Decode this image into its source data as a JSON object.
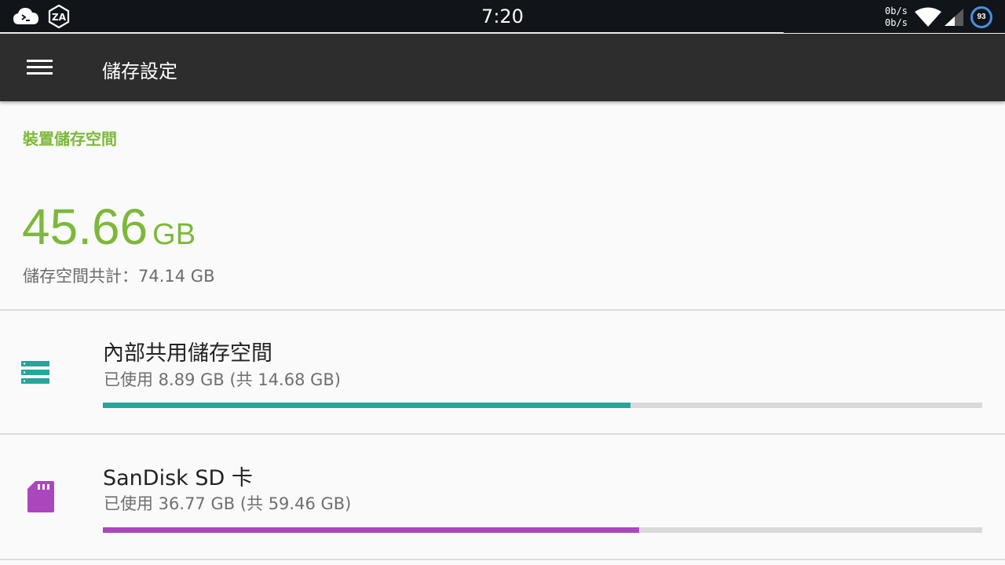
{
  "status_bar": {
    "time": "7:20",
    "net_up": "0b/s",
    "net_down": "0b/s",
    "battery": "93",
    "icons": [
      "cloud-terminal-icon",
      "za-app-icon",
      "wifi-icon",
      "cell-signal-icon",
      "battery-circle-icon"
    ]
  },
  "toolbar": {
    "title": "儲存設定",
    "menu_icon": "hamburger-menu-icon"
  },
  "summary": {
    "section_header": "裝置儲存空間",
    "used_value": "45.66",
    "used_unit": "GB",
    "total_label": "儲存空間共計：74.14 GB"
  },
  "volumes": [
    {
      "title": "內部共用儲存空間",
      "summary": "已使用 8.89 GB (共 14.68 GB)",
      "used_fraction": 0.6,
      "icon": "internal-storage-icon",
      "color": "#26a69a"
    },
    {
      "title": "SanDisk SD 卡",
      "summary": "已使用 36.77 GB (共 59.46 GB)",
      "used_fraction": 0.61,
      "icon": "sd-card-icon",
      "color": "#ab47bc"
    }
  ],
  "colors": {
    "accent": "#7cb83a",
    "toolbar": "#2d2d2d",
    "status_bar": "#111418",
    "background": "#fafafa"
  }
}
